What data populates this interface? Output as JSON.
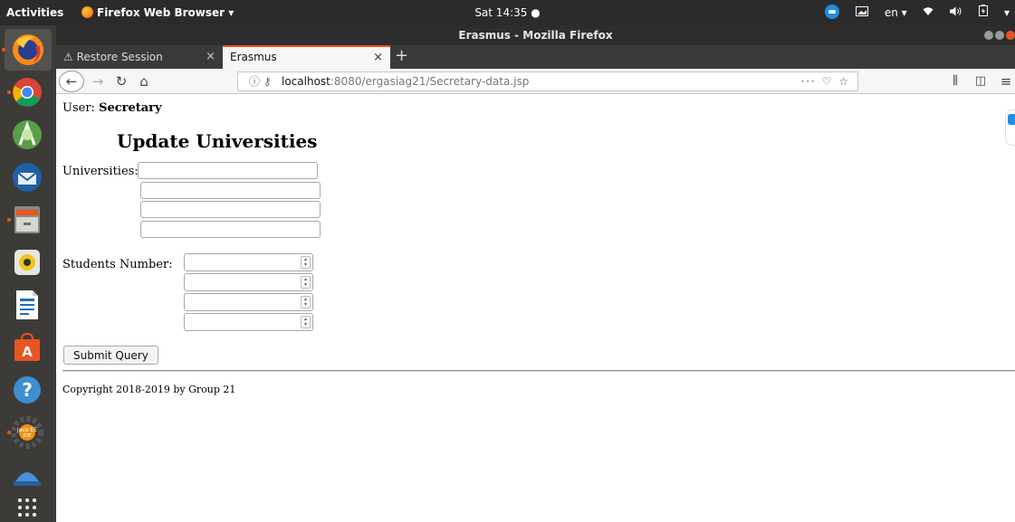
{
  "topbar": {
    "activities": "Activities",
    "app_menu": "Firefox Web Browser ▾",
    "clock": "Sat 14:35 ●",
    "lang": "en ▾",
    "tray_icons": [
      "teamviewer-icon",
      "display-icon",
      "wifi-icon",
      "volume-icon",
      "battery-icon",
      "menu-arrow-icon"
    ]
  },
  "dock": {
    "apps": [
      "firefox-icon",
      "chrome-icon",
      "android-studio-icon",
      "thunderbird-icon",
      "files-icon",
      "rhythmbox-icon",
      "writer-icon",
      "software-center-icon",
      "help-icon",
      "java-ee-ide-icon",
      "network-drive-icon",
      "show-apps-icon"
    ],
    "java_label": "Java EE IDE"
  },
  "window": {
    "title": "Erasmus - Mozilla Firefox",
    "tabs": [
      {
        "label": "Restore Session",
        "close": "×"
      },
      {
        "label": "Erasmus",
        "close": "×"
      }
    ],
    "new_tab": "+",
    "url": {
      "host": "localhost",
      "rest": ":8080/ergasiag21/Secretary-data.jsp",
      "actions": "··· ♡ ☆"
    }
  },
  "page": {
    "user_label": "User:",
    "user_name": "Secretary",
    "title": "Update Universities",
    "universities_label": "Universities:",
    "students_label": "Students Number:",
    "submit_label": "Submit Query",
    "copyright": "Copyright 2018-2019 by Group 21"
  }
}
